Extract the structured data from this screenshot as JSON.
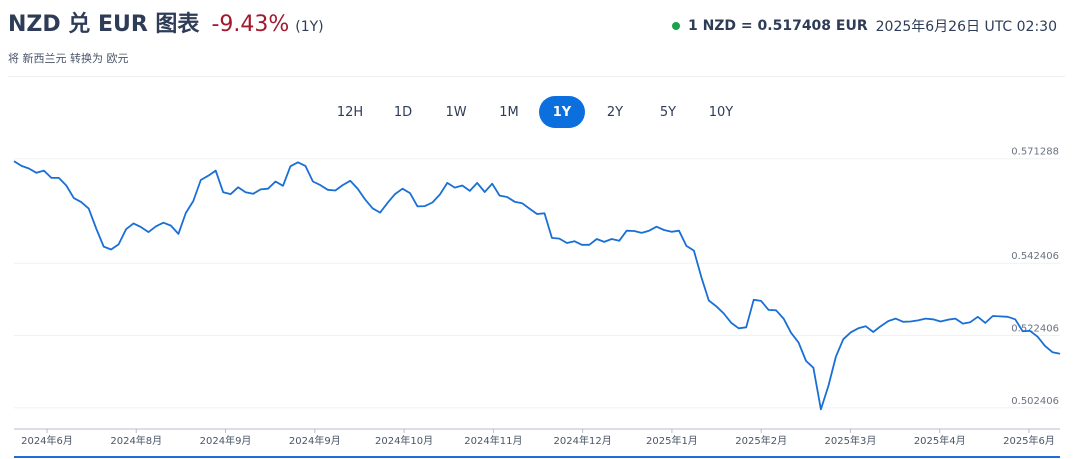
{
  "header": {
    "title": "NZD 兑 EUR 图表",
    "change": "-9.43%",
    "period": "(1Y)",
    "subtitle": "将 新西兰元 转换为 欧元",
    "rate": "1 NZD = 0.517408 EUR",
    "timestamp": "2025年6月26日 UTC 02:30",
    "status_color": "#1ba34b"
  },
  "tabs": [
    {
      "label": "12H",
      "active": false
    },
    {
      "label": "1D",
      "active": false
    },
    {
      "label": "1W",
      "active": false
    },
    {
      "label": "1M",
      "active": false
    },
    {
      "label": "1Y",
      "active": true
    },
    {
      "label": "2Y",
      "active": false
    },
    {
      "label": "5Y",
      "active": false
    },
    {
      "label": "10Y",
      "active": false
    }
  ],
  "colors": {
    "line": "#1a6fd6",
    "accent": "#0b6fde",
    "negative": "#a2182d"
  },
  "chart_data": {
    "type": "line",
    "title": "",
    "xlabel": "",
    "ylabel": "",
    "ylim": [
      0.4974,
      0.5726
    ],
    "y_ticks": [
      "0.571288",
      "0.542406",
      "0.522406",
      "0.502406"
    ],
    "x_ticks": [
      "2024年6月",
      "2024年8月",
      "2024年9月",
      "2024年9月",
      "2024年10月",
      "2024年11月",
      "2024年12月",
      "2025年1月",
      "2025年2月",
      "2025年3月",
      "2025年4月",
      "2025年6月"
    ],
    "series": [
      {
        "name": "",
        "values": [
          0.5706,
          0.5693,
          0.5686,
          0.5674,
          0.568,
          0.566,
          0.566,
          0.5639,
          0.5604,
          0.5593,
          0.5575,
          0.552,
          0.547,
          0.5462,
          0.5476,
          0.5518,
          0.5534,
          0.5524,
          0.551,
          0.5526,
          0.5536,
          0.5528,
          0.5505,
          0.5563,
          0.5596,
          0.5654,
          0.5666,
          0.568,
          0.562,
          0.5615,
          0.5634,
          0.562,
          0.5616,
          0.5628,
          0.563,
          0.565,
          0.5638,
          0.5692,
          0.5703,
          0.5693,
          0.565,
          0.564,
          0.5627,
          0.5625,
          0.564,
          0.5652,
          0.563,
          0.56,
          0.5576,
          0.5564,
          0.5591,
          0.5615,
          0.563,
          0.5618,
          0.5581,
          0.5582,
          0.5592,
          0.5614,
          0.5646,
          0.5633,
          0.5639,
          0.5624,
          0.5646,
          0.5621,
          0.5644,
          0.5611,
          0.5607,
          0.5594,
          0.559,
          0.5575,
          0.556,
          0.5562,
          0.5494,
          0.5492,
          0.548,
          0.5485,
          0.5475,
          0.5475,
          0.5491,
          0.5483,
          0.5491,
          0.5486,
          0.5514,
          0.5513,
          0.5508,
          0.5514,
          0.5525,
          0.5516,
          0.5511,
          0.5514,
          0.5472,
          0.5459,
          0.5385,
          0.5321,
          0.5305,
          0.5285,
          0.5259,
          0.5244,
          0.5247,
          0.5323,
          0.532,
          0.5295,
          0.5294,
          0.5271,
          0.5232,
          0.5205,
          0.5154,
          0.5135,
          0.502,
          0.5085,
          0.5166,
          0.5214,
          0.5233,
          0.5244,
          0.525,
          0.5234,
          0.525,
          0.5264,
          0.5271,
          0.5262,
          0.5263,
          0.5266,
          0.5271,
          0.5269,
          0.5263,
          0.5268,
          0.5271,
          0.5257,
          0.5261,
          0.5276,
          0.5259,
          0.5278,
          0.5277,
          0.5276,
          0.5269,
          0.5236,
          0.5237,
          0.5221,
          0.5195,
          0.5178,
          0.5174
        ]
      }
    ]
  }
}
